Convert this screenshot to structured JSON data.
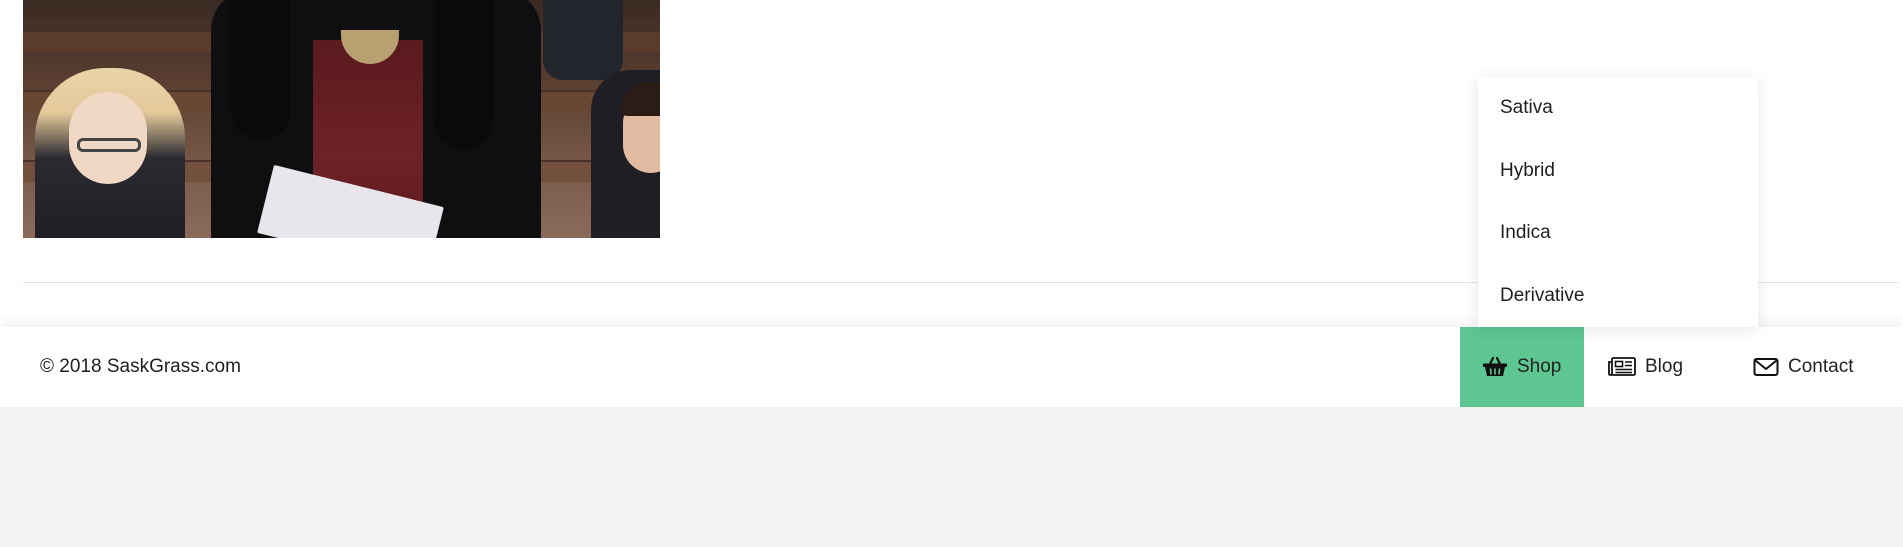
{
  "content": {
    "photo_alt": "Woman standing in parliament holding papers"
  },
  "footer": {
    "copyright": "© 2018 SaskGrass.com",
    "nav": [
      {
        "label": "Shop",
        "icon": "basket-icon",
        "active": true
      },
      {
        "label": "Blog",
        "icon": "newspaper-icon",
        "active": false
      },
      {
        "label": "Contact",
        "icon": "envelope-icon",
        "active": false
      }
    ]
  },
  "shop_menu": {
    "items": [
      {
        "label": "Sativa"
      },
      {
        "label": "Hybrid"
      },
      {
        "label": "Indica"
      },
      {
        "label": "Derivative"
      }
    ]
  },
  "colors": {
    "accent": "#5ec690",
    "page_background": "#f2f2f2",
    "surface": "#ffffff",
    "divider": "#e3e3e3"
  }
}
